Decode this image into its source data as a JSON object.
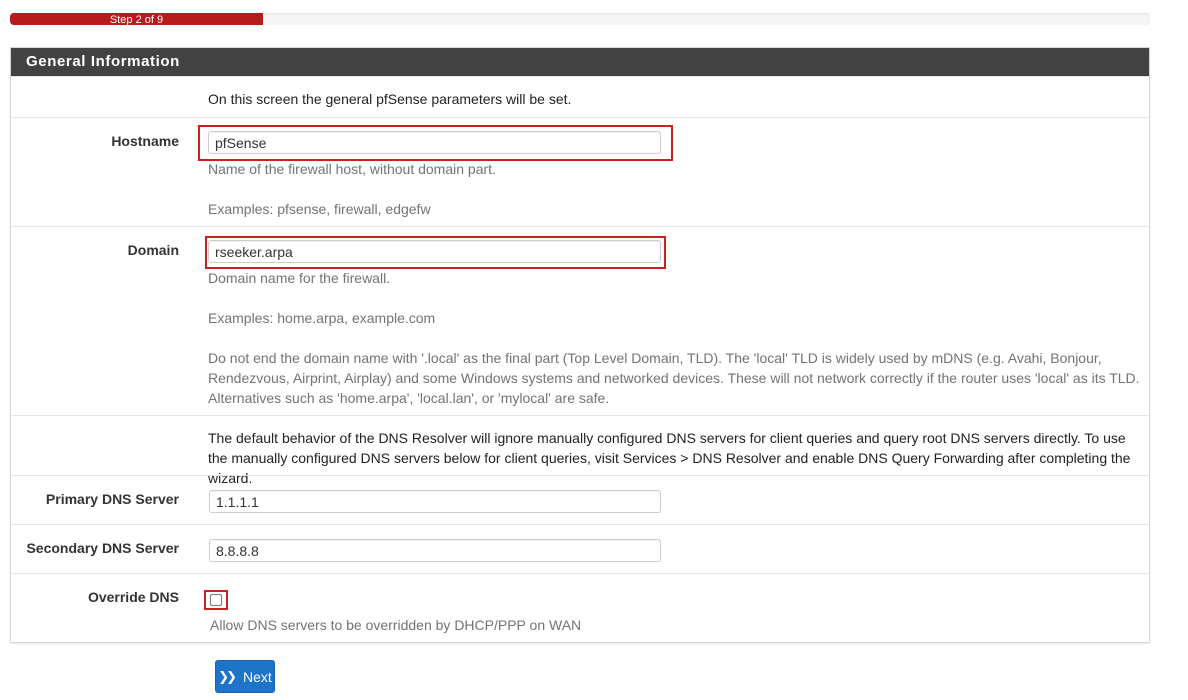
{
  "progress": {
    "label": "Step 2 of 9",
    "fraction": 0.222,
    "color": "#b71c1c"
  },
  "panel": {
    "title": "General Information",
    "intro": "On this screen the general pfSense parameters will be set."
  },
  "hostname": {
    "label": "Hostname",
    "value": "pfSense",
    "help_1": "Name of the firewall host, without domain part.",
    "help_2": "Examples: pfsense, firewall, edgefw"
  },
  "domain": {
    "label": "Domain",
    "value": "rseeker.arpa",
    "help_1": "Domain name for the firewall.",
    "help_2": "Examples: home.arpa, example.com",
    "help_3": "Do not end the domain name with '.local' as the final part (Top Level Domain, TLD). The 'local' TLD is widely used by mDNS (e.g. Avahi, Bonjour, Rendezvous, Airprint, Airplay) and some Windows systems and networked devices. These will not network correctly if the router uses 'local' as its TLD. Alternatives such as 'home.arpa', 'local.lan', or 'mylocal' are safe."
  },
  "dns_note": "The default behavior of the DNS Resolver will ignore manually configured DNS servers for client queries and query root DNS servers directly. To use the manually configured DNS servers below for client queries, visit Services > DNS Resolver and enable DNS Query Forwarding after completing the wizard.",
  "primary_dns": {
    "label": "Primary DNS Server",
    "value": "1.1.1.1"
  },
  "secondary_dns": {
    "label": "Secondary DNS Server",
    "value": "8.8.8.8"
  },
  "override_dns": {
    "label": "Override DNS",
    "checked": false,
    "help": "Allow DNS servers to be overridden by DHCP/PPP on WAN"
  },
  "next_button": {
    "label": "Next",
    "icon": "double-chevron-right-icon"
  },
  "colors": {
    "heading_bg": "#424242",
    "highlight": "#cc1f1f",
    "button": "#1e74c9"
  }
}
